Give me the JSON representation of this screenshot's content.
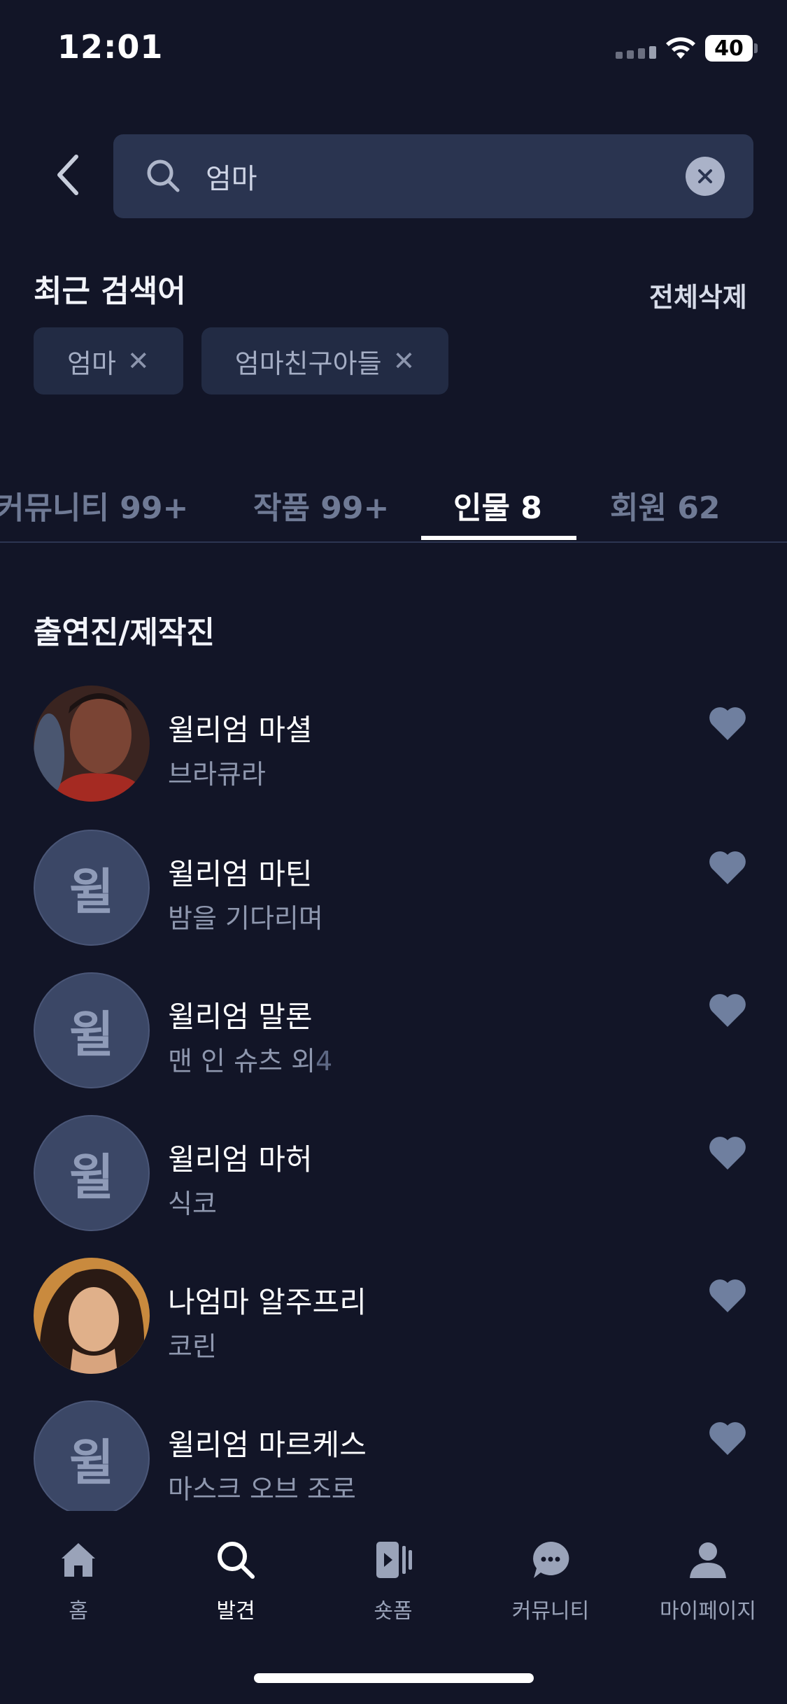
{
  "status_bar": {
    "time": "12:01",
    "battery": "40"
  },
  "search": {
    "query": "엄마",
    "placeholder": ""
  },
  "recent": {
    "title": "최근 검색어",
    "clear_all": "전체삭제",
    "chips": [
      {
        "label": "엄마"
      },
      {
        "label": "엄마친구아들"
      }
    ],
    "remove_glyph": "✕"
  },
  "tabs": [
    {
      "label": "커뮤니티 99+"
    },
    {
      "label": "작품 99+"
    },
    {
      "label": "인물 8"
    },
    {
      "label": "회원 62"
    }
  ],
  "active_tab": "인물 8",
  "section": {
    "title": "출연진/제작진"
  },
  "people": [
    {
      "name": "윌리엄 마셜",
      "work": "브라큐라",
      "extra": "",
      "avatar": "photo",
      "initial": ""
    },
    {
      "name": "윌리엄 마틴",
      "work": "밤을 기다리며",
      "extra": "",
      "avatar": "placeholder",
      "initial": "윌"
    },
    {
      "name": "윌리엄 말론",
      "work": "맨 인 슈츠 외",
      "extra": "4",
      "avatar": "placeholder",
      "initial": "윌"
    },
    {
      "name": "윌리엄 마허",
      "work": "식코",
      "extra": "",
      "avatar": "placeholder",
      "initial": "윌"
    },
    {
      "name": "나엄마 알주프리",
      "work": "코린",
      "extra": "",
      "avatar": "photo",
      "initial": ""
    },
    {
      "name": "윌리엄 마르케스",
      "work": "마스크 오브 조로",
      "extra": "",
      "avatar": "placeholder",
      "initial": "윌"
    }
  ],
  "bottom_nav": [
    {
      "label": "홈",
      "icon": "home-icon"
    },
    {
      "label": "발견",
      "icon": "search-icon"
    },
    {
      "label": "숏폼",
      "icon": "shortform-icon"
    },
    {
      "label": "커뮤니티",
      "icon": "chat-icon"
    },
    {
      "label": "마이페이지",
      "icon": "person-icon"
    }
  ],
  "active_nav": "발견",
  "colors": {
    "background": "#121527",
    "search_box": "#2a3450",
    "chip": "#222b44",
    "muted_text": "#8e97ae",
    "heart": "#6f7f9f"
  }
}
